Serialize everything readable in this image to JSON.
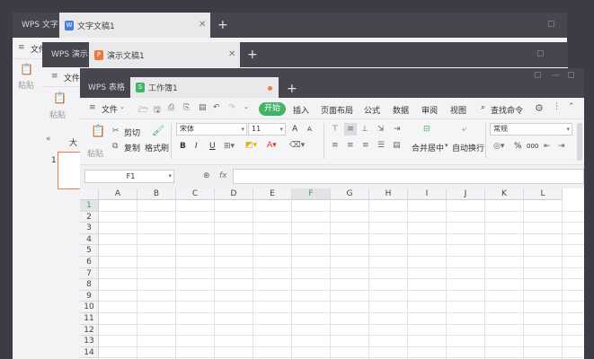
{
  "window1": {
    "tab": "WPS 文字",
    "doc_tab": "文字文稿1",
    "doc_icon": "W",
    "menu": "文件",
    "paste": "粘贴",
    "new_tab": "+"
  },
  "window2": {
    "tab": "WPS 演示",
    "doc_tab": "演示文稿1",
    "doc_icon": "P",
    "menu": "文件",
    "paste": "粘贴",
    "slide_num": "1",
    "side_label": "大",
    "collapse": "«",
    "new_tab": "+"
  },
  "window3": {
    "tab": "WPS 表格",
    "doc_tab": "工作簿1",
    "doc_icon": "S",
    "new_tab": "+",
    "menu": {
      "file": "文件",
      "start": "开始",
      "items": [
        "插入",
        "页面布局",
        "公式",
        "数据",
        "审阅",
        "视图"
      ],
      "search": "查找命令"
    },
    "ribbon": {
      "paste": "粘贴",
      "cut": "剪切",
      "copy": "复制",
      "format_painter": "格式刷",
      "font": "宋体",
      "size": "11",
      "bold": "B",
      "italic": "I",
      "underline": "U",
      "merge": "合并居中",
      "wrap": "自动换行",
      "number_format": "常规",
      "percent": "%",
      "thousands": "000",
      "font_grow": "A",
      "font_shrink": "A"
    },
    "formula_bar": {
      "cell_ref": "F1",
      "fx": "fx",
      "value": ""
    },
    "columns": [
      "A",
      "B",
      "C",
      "D",
      "E",
      "F",
      "G",
      "H",
      "I",
      "J",
      "K",
      "L"
    ],
    "rows": [
      "1",
      "2",
      "3",
      "4",
      "5",
      "6",
      "7",
      "8",
      "9",
      "10",
      "11",
      "12",
      "13",
      "14"
    ],
    "selected_column": "F",
    "selected_row": "1",
    "accent": "#3fb465"
  }
}
